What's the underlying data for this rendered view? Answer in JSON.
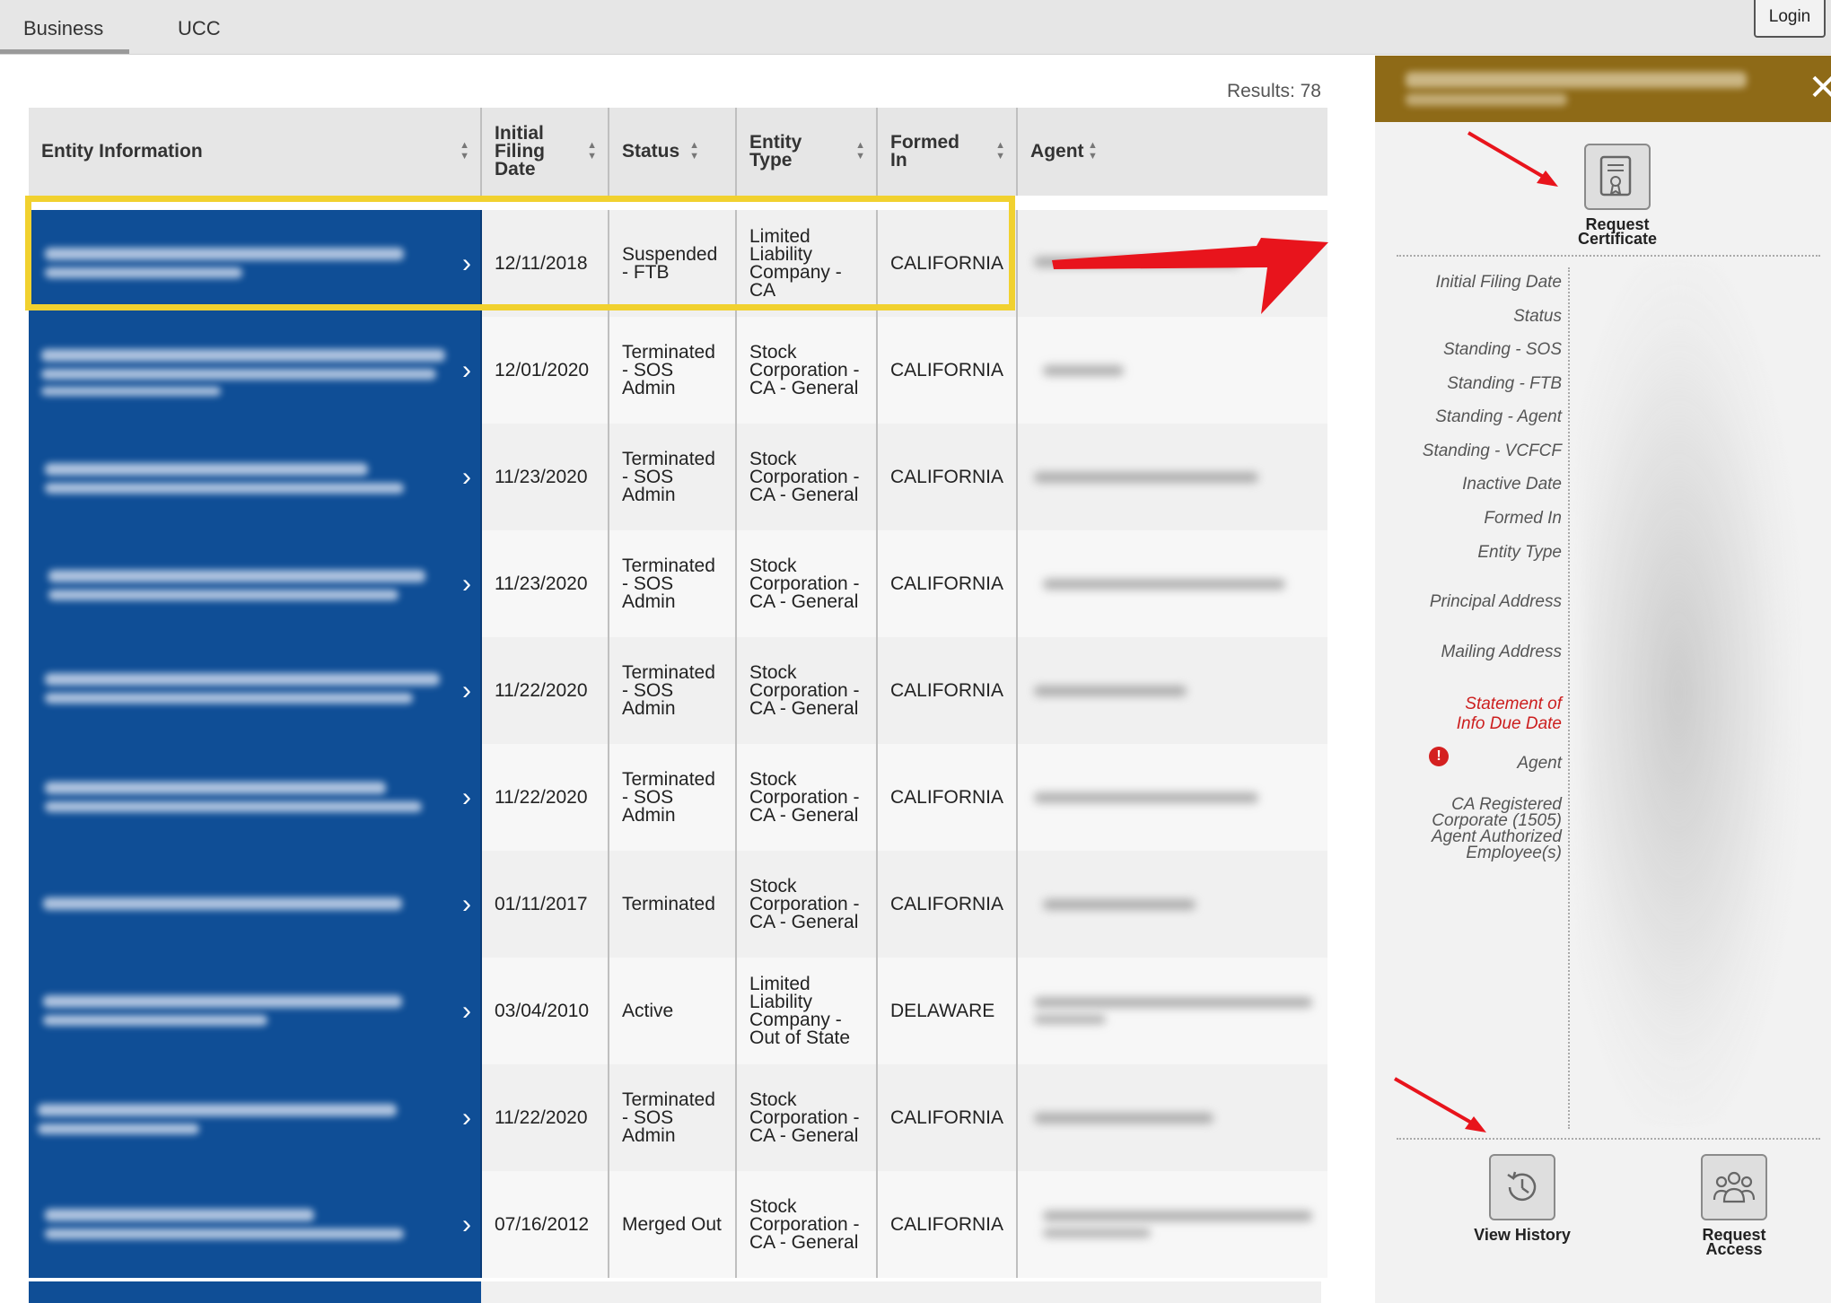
{
  "tabs": [
    {
      "label": "Business"
    },
    {
      "label": "UCC"
    }
  ],
  "login_label": "Login",
  "results_label": "Results: 78",
  "columns": [
    {
      "label": "Entity Information"
    },
    {
      "label": "Initial Filing Date"
    },
    {
      "label": "Status"
    },
    {
      "label": "Entity Type"
    },
    {
      "label": "Formed In"
    },
    {
      "label": "Agent"
    }
  ],
  "rows": [
    {
      "date": "12/11/2018",
      "status": "Suspended - FTB",
      "type": "Limited Liability Company - CA",
      "formed": "CALIFORNIA"
    },
    {
      "date": "12/01/2020",
      "status": "Terminated - SOS Admin",
      "type": "Stock Corporation - CA - General",
      "formed": "CALIFORNIA"
    },
    {
      "date": "11/23/2020",
      "status": "Terminated - SOS Admin",
      "type": "Stock Corporation - CA - General",
      "formed": "CALIFORNIA"
    },
    {
      "date": "11/23/2020",
      "status": "Terminated - SOS Admin",
      "type": "Stock Corporation - CA - General",
      "formed": "CALIFORNIA"
    },
    {
      "date": "11/22/2020",
      "status": "Terminated - SOS Admin",
      "type": "Stock Corporation - CA - General",
      "formed": "CALIFORNIA"
    },
    {
      "date": "11/22/2020",
      "status": "Terminated - SOS Admin",
      "type": "Stock Corporation - CA - General",
      "formed": "CALIFORNIA"
    },
    {
      "date": "01/11/2017",
      "status": "Terminated",
      "type": "Stock Corporation - CA - General",
      "formed": "CALIFORNIA"
    },
    {
      "date": "03/04/2010",
      "status": "Active",
      "type": "Limited Liability Company - Out of State",
      "formed": "DELAWARE"
    },
    {
      "date": "11/22/2020",
      "status": "Terminated - SOS Admin",
      "type": "Stock Corporation - CA - General",
      "formed": "CALIFORNIA"
    },
    {
      "date": "07/16/2012",
      "status": "Merged Out",
      "type": "Stock Corporation - CA - General",
      "formed": "CALIFORNIA"
    }
  ],
  "panel": {
    "request_certificate": "Request Certificate",
    "labels": [
      "Initial Filing Date",
      "Status",
      "Standing - SOS",
      "Standing - FTB",
      "Standing - Agent",
      "Standing - VCFCF",
      "Inactive Date",
      "Formed In",
      "Entity Type",
      "Principal Address",
      "Mailing Address",
      "Statement of Info Due Date",
      "Agent",
      "CA Registered Corporate (1505) Agent Authorized Employee(s)"
    ],
    "view_history": "View History",
    "request_access": "Request Access"
  },
  "colors": {
    "entity_blue": "#0f4e96",
    "panel_header": "#8e6a17",
    "highlight": "#f1d12f",
    "annotation_red": "#e8141c"
  }
}
